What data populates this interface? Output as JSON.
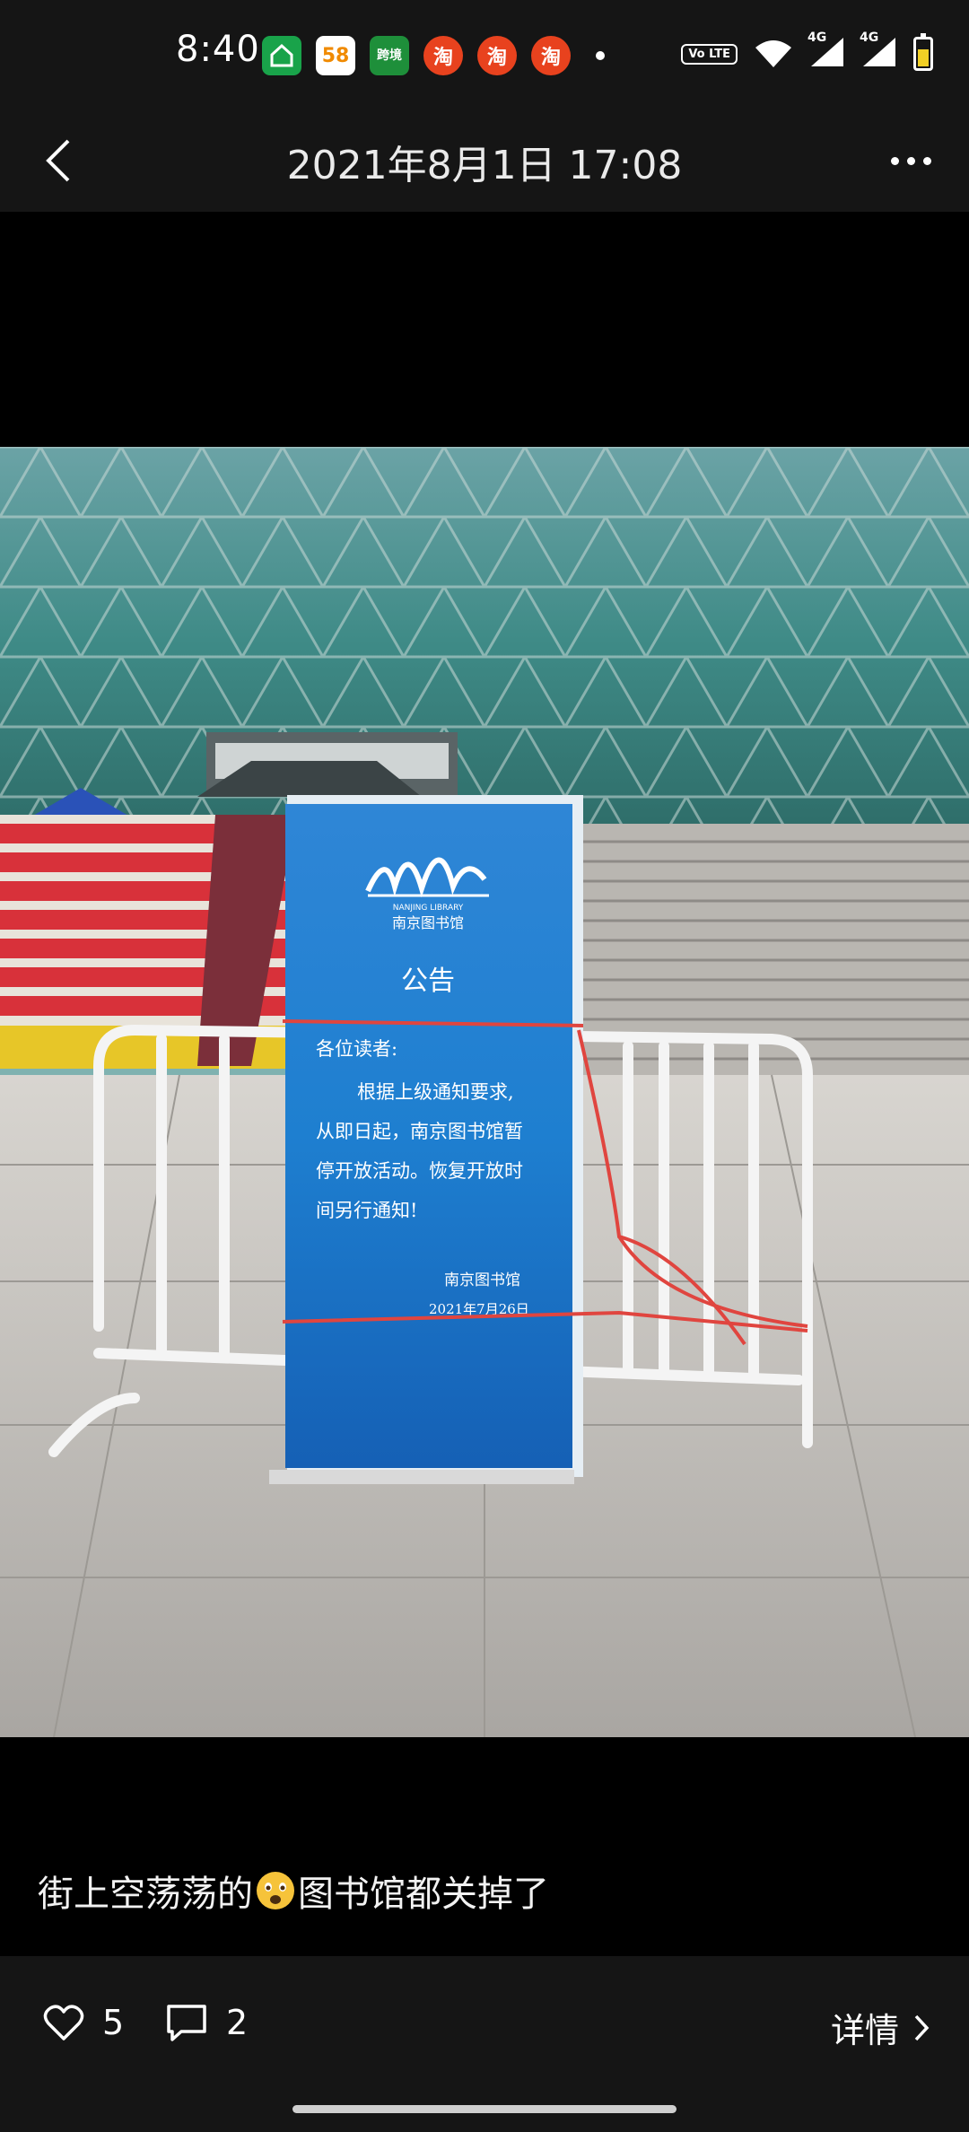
{
  "status_bar": {
    "time": "8:40",
    "app_icons": [
      "home-app-icon",
      "58-app-icon",
      "kuajing-app-icon",
      "taobao-icon",
      "taobao-icon",
      "taobao-icon"
    ],
    "app_58_label": "58",
    "app_kj_label": "跨境",
    "app_tao_label": "淘",
    "volte_label": "Vo LTE",
    "signal_label_1": "4G",
    "signal_label_2": "4G"
  },
  "header": {
    "title": "2021年8月1日 17:08"
  },
  "post": {
    "caption_before": "街上空荡荡的",
    "caption_after": "图书馆都关掉了",
    "photo": {
      "sign_heading": "公告",
      "sign_logo_text": "NANJING LIBRARY",
      "sign_logo_cn": "南京图书馆",
      "sign_greeting": "各位读者:",
      "sign_body_1": "根据上级通知要求,",
      "sign_body_2": "从即日起，南京图书馆暂",
      "sign_body_3": "停开放活动。恢复开放时",
      "sign_body_4": "间另行通知!",
      "sign_signature": "南京图书馆",
      "sign_date": "2021年7月26日"
    }
  },
  "actions": {
    "likes": "5",
    "comments": "2",
    "detail_label": "详情"
  },
  "colors": {
    "bar_bg": "#151515",
    "sign_blue": "#1f74c9",
    "stairs_red": "#d8313a"
  }
}
